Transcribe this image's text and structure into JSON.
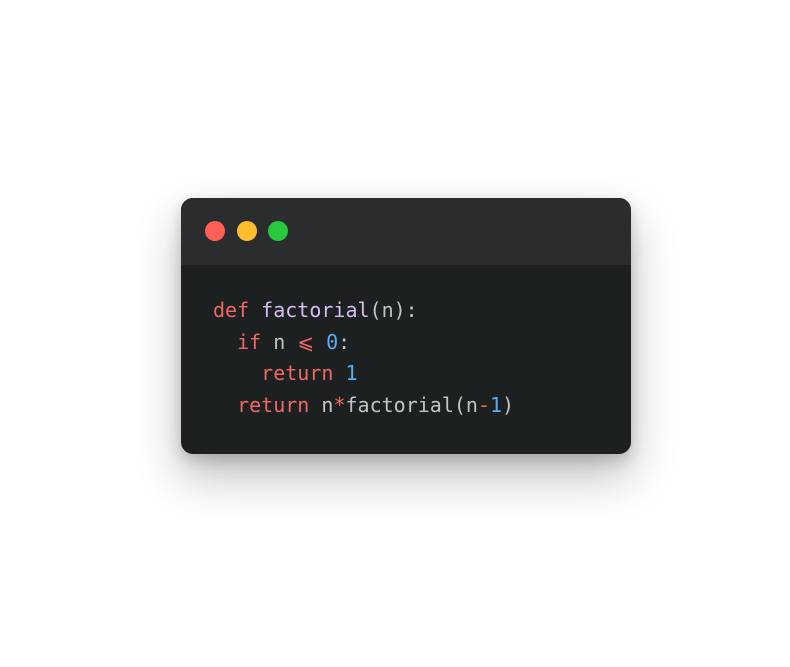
{
  "window": {
    "controls": [
      {
        "name": "close-button",
        "color": "#ff5f56"
      },
      {
        "name": "minimize-button",
        "color": "#ffbd2e"
      },
      {
        "name": "maximize-button",
        "color": "#27c93f"
      }
    ]
  },
  "colors": {
    "keyword": "#f0685f",
    "function": "#d7bdf0",
    "number": "#58aef0",
    "plain": "#c0c4c9"
  },
  "code": {
    "lines": [
      [
        {
          "t": "def",
          "c": "keyword"
        },
        {
          "t": " ",
          "c": "plain"
        },
        {
          "t": "factorial",
          "c": "function"
        },
        {
          "t": "(n):",
          "c": "plain"
        }
      ],
      [
        {
          "t": "  ",
          "c": "plain"
        },
        {
          "t": "if",
          "c": "keyword"
        },
        {
          "t": " n ",
          "c": "plain"
        },
        {
          "t": "⩽",
          "c": "keyword"
        },
        {
          "t": " ",
          "c": "plain"
        },
        {
          "t": "0",
          "c": "number"
        },
        {
          "t": ":",
          "c": "plain"
        }
      ],
      [
        {
          "t": "    ",
          "c": "plain"
        },
        {
          "t": "return",
          "c": "keyword"
        },
        {
          "t": " ",
          "c": "plain"
        },
        {
          "t": "1",
          "c": "number"
        }
      ],
      [
        {
          "t": "  ",
          "c": "plain"
        },
        {
          "t": "return",
          "c": "keyword"
        },
        {
          "t": " n",
          "c": "plain"
        },
        {
          "t": "*",
          "c": "keyword"
        },
        {
          "t": "factorial(n",
          "c": "plain"
        },
        {
          "t": "-",
          "c": "keyword"
        },
        {
          "t": "1",
          "c": "number"
        },
        {
          "t": ")",
          "c": "plain"
        }
      ]
    ]
  }
}
